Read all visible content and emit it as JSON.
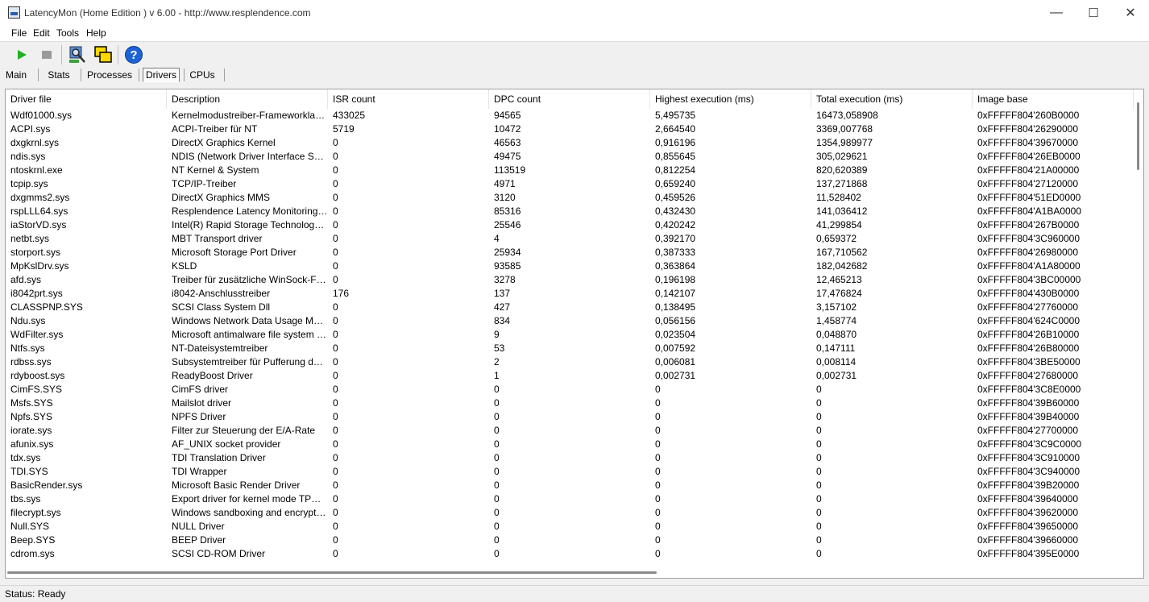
{
  "window": {
    "title": "LatencyMon  (Home Edition )  v 6.00 - http://www.resplendence.com",
    "controls": {
      "minimize": "—",
      "maximize": "☐",
      "close": "✕"
    }
  },
  "menu": [
    {
      "label": "File"
    },
    {
      "label": "Edit"
    },
    {
      "label": "Tools"
    },
    {
      "label": "Help"
    }
  ],
  "toolbar": {
    "icons": [
      "play-icon",
      "stop-icon",
      "search-driver-icon",
      "windows-icon",
      "help-icon"
    ],
    "help_glyph": "?"
  },
  "tabs": [
    {
      "label": "Main"
    },
    {
      "label": "Stats"
    },
    {
      "label": "Processes"
    },
    {
      "label": "Drivers",
      "active": true
    },
    {
      "label": "CPUs"
    }
  ],
  "table": {
    "columns": [
      "Driver file",
      "Description",
      "ISR count",
      "DPC count",
      "Highest execution (ms)",
      "Total execution (ms)",
      "Image base"
    ],
    "rows": [
      [
        "Wdf01000.sys",
        "Kernelmodustreiber-Frameworklaufzeit",
        "433025",
        "94565",
        "5,495735",
        "16473,058908",
        "0xFFFFF804'260B0000"
      ],
      [
        "ACPI.sys",
        "ACPI-Treiber für NT",
        "5719",
        "10472",
        "2,664540",
        "3369,007768",
        "0xFFFFF804'26290000"
      ],
      [
        "dxgkrnl.sys",
        "DirectX Graphics Kernel",
        "0",
        "46563",
        "0,916196",
        "1354,989977",
        "0xFFFFF804'39670000"
      ],
      [
        "ndis.sys",
        "NDIS (Network Driver Interface Spe...",
        "0",
        "49475",
        "0,855645",
        "305,029621",
        "0xFFFFF804'26EB0000"
      ],
      [
        "ntoskrnl.exe",
        "NT Kernel & System",
        "0",
        "113519",
        "0,812254",
        "820,620389",
        "0xFFFFF804'21A00000"
      ],
      [
        "tcpip.sys",
        "TCP/IP-Treiber",
        "0",
        "4971",
        "0,659240",
        "137,271868",
        "0xFFFFF804'27120000"
      ],
      [
        "dxgmms2.sys",
        "DirectX Graphics MMS",
        "0",
        "3120",
        "0,459526",
        "11,528402",
        "0xFFFFF804'51ED0000"
      ],
      [
        "rspLLL64.sys",
        "Resplendence Latency Monitoring a...",
        "0",
        "85316",
        "0,432430",
        "141,036412",
        "0xFFFFF804'A1BA0000"
      ],
      [
        "iaStorVD.sys",
        "Intel(R) Rapid Storage Technology ...",
        "0",
        "25546",
        "0,420242",
        "41,299854",
        "0xFFFFF804'267B0000"
      ],
      [
        "netbt.sys",
        "MBT Transport driver",
        "0",
        "4",
        "0,392170",
        "0,659372",
        "0xFFFFF804'3C960000"
      ],
      [
        "storport.sys",
        "Microsoft Storage Port Driver",
        "0",
        "25934",
        "0,387333",
        "167,710562",
        "0xFFFFF804'26980000"
      ],
      [
        "MpKslDrv.sys",
        "KSLD",
        "0",
        "93585",
        "0,363864",
        "182,042682",
        "0xFFFFF804'A1A80000"
      ],
      [
        "afd.sys",
        "Treiber für zusätzliche WinSock-Fun...",
        "0",
        "3278",
        "0,196198",
        "12,465213",
        "0xFFFFF804'3BC00000"
      ],
      [
        "i8042prt.sys",
        "i8042-Anschlusstreiber",
        "176",
        "137",
        "0,142107",
        "17,476824",
        "0xFFFFF804'430B0000"
      ],
      [
        "CLASSPNP.SYS",
        "SCSI Class System Dll",
        "0",
        "427",
        "0,138495",
        "3,157102",
        "0xFFFFF804'27760000"
      ],
      [
        "Ndu.sys",
        "Windows Network Data Usage Monit...",
        "0",
        "834",
        "0,056156",
        "1,458774",
        "0xFFFFF804'624C0000"
      ],
      [
        "WdFilter.sys",
        "Microsoft antimalware file system filt...",
        "0",
        "9",
        "0,023504",
        "0,048870",
        "0xFFFFF804'26B10000"
      ],
      [
        "Ntfs.sys",
        "NT-Dateisystemtreiber",
        "0",
        "53",
        "0,007592",
        "0,147111",
        "0xFFFFF804'26B80000"
      ],
      [
        "rdbss.sys",
        "Subsystemtreiber für Pufferung des...",
        "0",
        "2",
        "0,006081",
        "0,008114",
        "0xFFFFF804'3BE50000"
      ],
      [
        "rdyboost.sys",
        "ReadyBoost Driver",
        "0",
        "1",
        "0,002731",
        "0,002731",
        "0xFFFFF804'27680000"
      ],
      [
        "CimFS.SYS",
        "CimFS driver",
        "0",
        "0",
        "0",
        "0",
        "0xFFFFF804'3C8E0000"
      ],
      [
        "Msfs.SYS",
        "Mailslot driver",
        "0",
        "0",
        "0",
        "0",
        "0xFFFFF804'39B60000"
      ],
      [
        "Npfs.SYS",
        "NPFS Driver",
        "0",
        "0",
        "0",
        "0",
        "0xFFFFF804'39B40000"
      ],
      [
        "iorate.sys",
        "Filter zur Steuerung der E/A-Rate",
        "0",
        "0",
        "0",
        "0",
        "0xFFFFF804'27700000"
      ],
      [
        "afunix.sys",
        "AF_UNIX socket provider",
        "0",
        "0",
        "0",
        "0",
        "0xFFFFF804'3C9C0000"
      ],
      [
        "tdx.sys",
        "TDI Translation Driver",
        "0",
        "0",
        "0",
        "0",
        "0xFFFFF804'3C910000"
      ],
      [
        "TDI.SYS",
        "TDI Wrapper",
        "0",
        "0",
        "0",
        "0",
        "0xFFFFF804'3C940000"
      ],
      [
        "BasicRender.sys",
        "Microsoft Basic Render Driver",
        "0",
        "0",
        "0",
        "0",
        "0xFFFFF804'39B20000"
      ],
      [
        "tbs.sys",
        "Export driver for kernel mode TPM API",
        "0",
        "0",
        "0",
        "0",
        "0xFFFFF804'39640000"
      ],
      [
        "filecrypt.sys",
        "Windows sandboxing and encryptio...",
        "0",
        "0",
        "0",
        "0",
        "0xFFFFF804'39620000"
      ],
      [
        "Null.SYS",
        "NULL Driver",
        "0",
        "0",
        "0",
        "0",
        "0xFFFFF804'39650000"
      ],
      [
        "Beep.SYS",
        "BEEP Driver",
        "0",
        "0",
        "0",
        "0",
        "0xFFFFF804'39660000"
      ],
      [
        "cdrom.sys",
        "SCSI CD-ROM Driver",
        "0",
        "0",
        "0",
        "0",
        "0xFFFFF804'395E0000"
      ]
    ]
  },
  "status": {
    "text": "Status: Ready"
  }
}
